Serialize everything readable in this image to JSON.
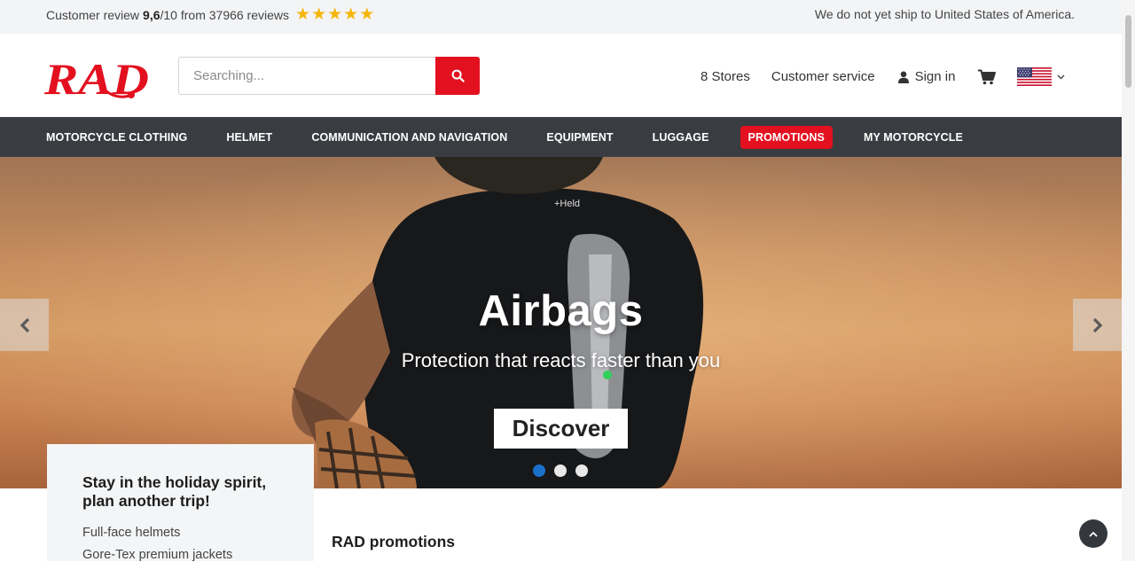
{
  "topbar": {
    "review_prefix": "Customer review",
    "review_score": "9,6",
    "review_suffix": "/10 from 37966 reviews",
    "rating_stars": 5,
    "shipping_notice": "We do not yet ship to United States of America."
  },
  "header": {
    "logo_text": "RAD",
    "search_placeholder": "Searching...",
    "stores": "8 Stores",
    "customer_service": "Customer service",
    "sign_in": "Sign in",
    "language_flag": "us-flag-icon"
  },
  "nav": {
    "items": [
      {
        "label": "MOTORCYCLE CLOTHING"
      },
      {
        "label": "HELMET"
      },
      {
        "label": "COMMUNICATION AND NAVIGATION"
      },
      {
        "label": "EQUIPMENT"
      },
      {
        "label": "LUGGAGE"
      },
      {
        "label": "PROMOTIONS"
      },
      {
        "label": "MY MOTORCYCLE"
      }
    ]
  },
  "hero": {
    "title": "Airbags",
    "subtitle": "Protection that reacts faster than you",
    "cta": "Discover",
    "slide_count": 3,
    "active_slide": 1
  },
  "sidebox": {
    "title": "Stay in the holiday spirit, plan another trip!",
    "links": [
      "Full-face helmets",
      "Gore-Tex premium jackets"
    ]
  },
  "promotions": {
    "heading": "RAD promotions"
  },
  "colors": {
    "brand_red": "#e3101f",
    "nav_bg": "#393d42",
    "star": "#f5b60a",
    "active_dot": "#1a6fc9"
  }
}
